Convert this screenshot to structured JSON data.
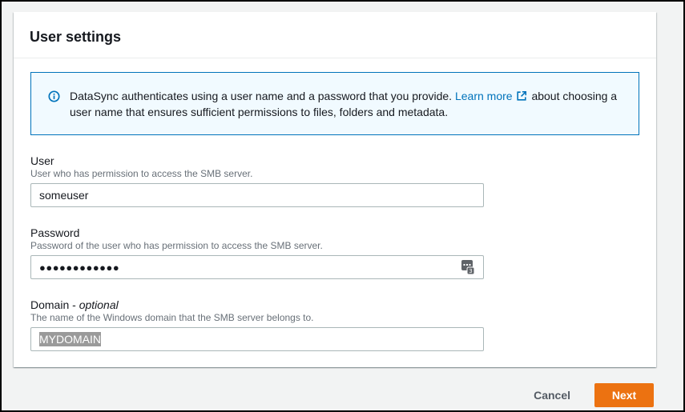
{
  "card": {
    "title": "User settings",
    "alert": {
      "icon": "info-icon",
      "text_before": "DataSync authenticates using a user name and a password that you provide.",
      "link_text": "Learn more",
      "link_icon": "external-link-icon",
      "text_after": "about choosing a user name that ensures sufficient permissions to files, folders and metadata.",
      "accent_color": "#0073bb"
    },
    "user": {
      "label": "User",
      "description": "User who has permission to access the SMB server.",
      "value": "someuser"
    },
    "password": {
      "label": "Password",
      "description": "Password of the user who has permission to access the SMB server.",
      "masked_value": "●●●●●●●●●●●●",
      "icon": "password-manager-key-icon"
    },
    "domain": {
      "label": "Domain -",
      "label_optional": "optional",
      "description": "The name of the Windows domain that the SMB server belongs to.",
      "value": "MYDOMAIN"
    }
  },
  "actions": {
    "cancel_label": "Cancel",
    "next_label": "Next",
    "primary_color": "#ec7211"
  }
}
